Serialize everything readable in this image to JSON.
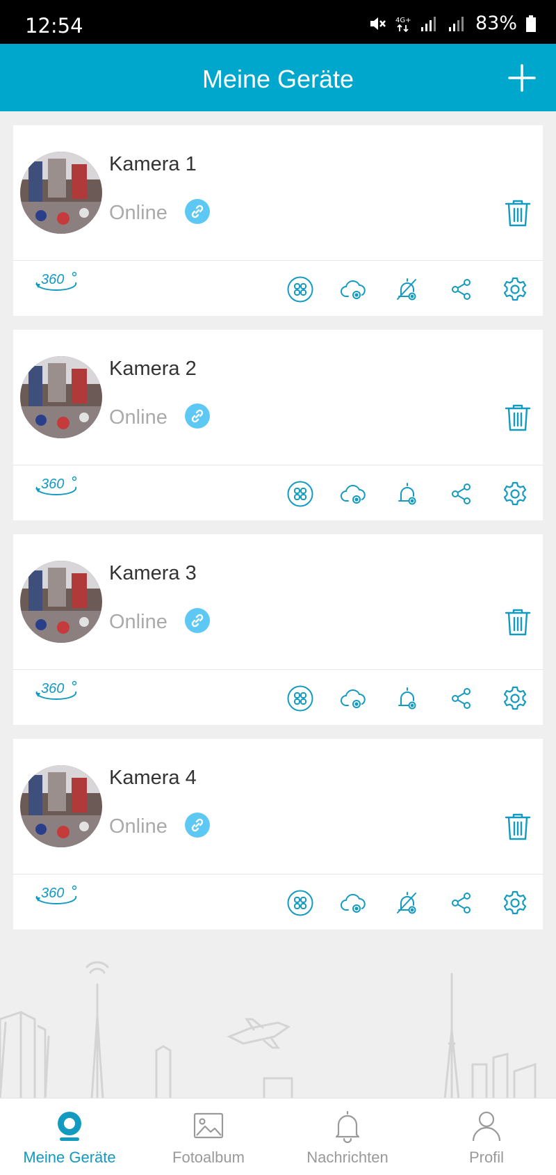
{
  "status_bar": {
    "time": "12:54",
    "battery": "83%"
  },
  "header": {
    "title": "Meine Geräte"
  },
  "devices": [
    {
      "name": "Kamera 1",
      "status": "Online",
      "alarm": "off"
    },
    {
      "name": "Kamera 2",
      "status": "Online",
      "alarm": "on"
    },
    {
      "name": "Kamera 3",
      "status": "Online",
      "alarm": "on"
    },
    {
      "name": "Kamera 4",
      "status": "Online",
      "alarm": "off"
    }
  ],
  "icons": {
    "pano": "360-icon",
    "multi": "multi-view-icon",
    "cloud": "cloud-settings-icon",
    "alarm": "alarm-settings-icon",
    "share": "share-icon",
    "settings": "gear-icon",
    "delete": "trash-icon",
    "link": "link-icon"
  },
  "bottom_nav": {
    "items": [
      {
        "label": "Meine Geräte",
        "active": true
      },
      {
        "label": "Fotoalbum",
        "active": false
      },
      {
        "label": "Nachrichten",
        "active": false
      },
      {
        "label": "Profil",
        "active": false
      }
    ]
  },
  "colors": {
    "brand": "#00a7cc",
    "icon": "#139ac0",
    "link_badge": "#5cc8f3",
    "muted_text": "#aaaaaa",
    "background": "#efefef"
  }
}
